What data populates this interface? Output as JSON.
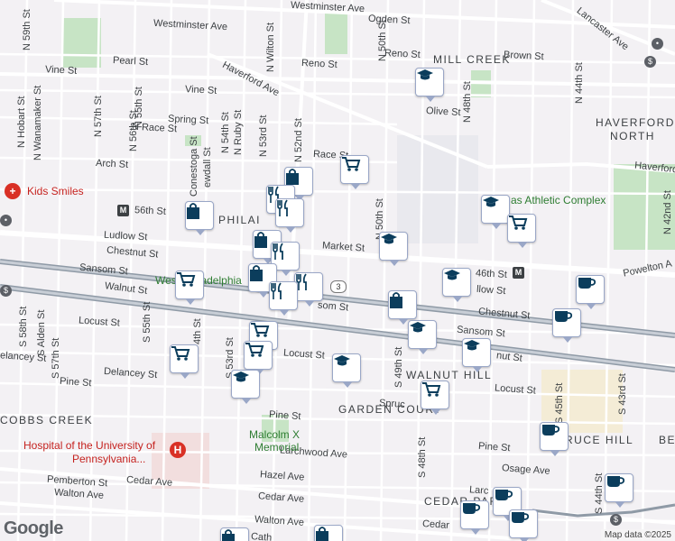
{
  "labels": {
    "westminster": "Westminster Ave",
    "ogden": "Ogden St",
    "lancaster": "Lancaster Ave",
    "pearl": "Pearl St",
    "reno1": "Reno St",
    "reno2": "Reno St",
    "brown": "Brown St",
    "vine": "Vine St",
    "vine2": "Vine St",
    "haverford": "Haverford Ave",
    "haverford2": "Haverford",
    "olive": "Olive St",
    "spring": "Spring St",
    "race": "N Race St",
    "race2": "Race St",
    "arch": "Arch St",
    "st56": "56th St",
    "st46": "46th St",
    "ludlow": "Ludlow St",
    "ludlow2": "llow St",
    "market": "Market St",
    "chestnut": "Chestnut St",
    "chestnut2": "Chestnut St",
    "sansom": "Sansom St",
    "sansom2": "som St",
    "sansom3": "Sansom St",
    "walnut": "Walnut St",
    "walnut2": "nut St",
    "locust": "Locust St",
    "locust2": "Locust St",
    "locust3": "Locust St",
    "delancey": "Delancey St",
    "delancey2": "elancey St",
    "spruce": "Spruc",
    "pine": "Pine St",
    "pine2": "Pine St",
    "pine3": "Pine St",
    "larchwood": "Larchwood Ave",
    "hazel": "Hazel Ave",
    "cedar": "Cedar Ave",
    "cedar2": "Cedar Ave",
    "cedar3": "Cedar",
    "pemberton": "Pemberton St",
    "walton": "Walton Ave",
    "walton2": "Walton Ave",
    "osage": "Osage Ave",
    "larc": "Larc",
    "cath": "Cath",
    "powelton": "Powelton A",
    "n59": "N 59th St",
    "n57": "N 57th St",
    "n56": "N 56th St",
    "n55": "N 55th St",
    "n54": "N 54th St",
    "n53": "N 53rd St",
    "n52": "N 52nd St",
    "n50": "N 50th St",
    "n48": "N 48th St",
    "n44": "N 44th St",
    "n42": "N 42nd St",
    "nhobart": "N Hobart St",
    "nwana": "N Wanamaker St",
    "nwilton": "N Wilton St",
    "nruby": "N Ruby St",
    "conestoga": "Conestoga St",
    "ewdall": "ewdall St",
    "s58": "S 58th St",
    "s57": "S 57th St",
    "s55": "S 55th St",
    "s54": "4th St",
    "s53": "S 53rd St",
    "s49": "S 49th St",
    "s48": "S 48th St",
    "s45": "S 45th St",
    "s44": "S 44th St",
    "s43": "S 43rd St",
    "salden": "S Alden St",
    "millcreek": "MILL CREEK",
    "havnorth1": "HAVERFORD",
    "havnorth2": "NORTH",
    "philad": "PHILAI",
    "westphila": "West Philadelphia",
    "walnuthill": "WALNUT HILL",
    "gardencourt": "GARDEN COURT",
    "sprucehill": "RUCE HILL",
    "cobbscreek": "COBBS CREEK",
    "cedarpark": "CEDAR PARK",
    "be": "BE",
    "kidssmiles": "Kids Smiles",
    "hospital1": "Hospital of the University of",
    "hospital2": "Pennsylvania...",
    "malcolm1": "Malcolm X",
    "malcolm2": "Memorial",
    "athletic": "as Athletic Complex",
    "route3": "3",
    "metro56": "M",
    "metro46": "M"
  },
  "google_logo": "Google",
  "attribution": "Map data ©2025",
  "pin_icons": [
    "shopping-bag-icon",
    "grocery-cart-icon",
    "school-icon",
    "restaurant-icon",
    "coffee-icon"
  ],
  "colors": {
    "pin_fill": "#0b3d5c",
    "pin_border": "#9aa7c7",
    "road_major": "#ffffff",
    "rail": "#8f9aa6",
    "park": "#c8e6c9"
  }
}
